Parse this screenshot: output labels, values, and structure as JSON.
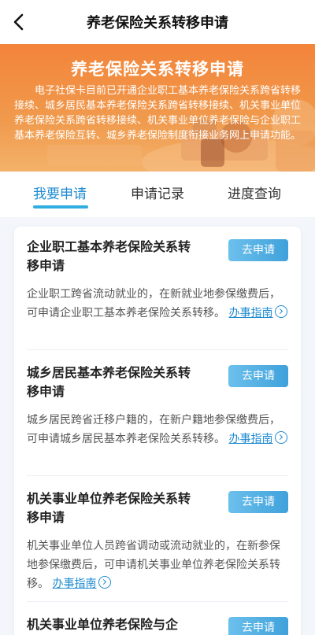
{
  "header": {
    "title": "养老保险关系转移申请"
  },
  "banner": {
    "title": "养老保险关系转移申请",
    "description": "电子社保卡目前已开通企业职工基本养老保险关系跨省转移接续、城乡居民基本养老保险关系跨省转移接续、机关事业单位养老保险关系跨省转移接续、机关事业单位养老保险与企业职工基本养老保险互转、城乡养老保险制度衔接业务网上申请功能。"
  },
  "tabs": [
    {
      "label": "我要申请",
      "active": true
    },
    {
      "label": "申请记录",
      "active": false
    },
    {
      "label": "进度查询",
      "active": false
    }
  ],
  "items": [
    {
      "title": "企业职工基本养老保险关系转移申请",
      "button": "去申请",
      "desc": "企业职工跨省流动就业的，在新就业地参保缴费后，可申请企业职工基本养老保险关系转移。",
      "link": "办事指南"
    },
    {
      "title": "城乡居民基本养老保险关系转移申请",
      "button": "去申请",
      "desc": "城乡居民跨省迁移户籍的，在新户籍地参保缴费后，可申请城乡居民基本养老保险关系转移。",
      "link": "办事指南"
    },
    {
      "title": "机关事业单位养老保险关系转移申请",
      "button": "去申请",
      "desc": "机关事业单位人员跨省调动或流动就业的，在新参保地参保缴费后，可申请机关事业单位养老保险关系转移。",
      "link": "办事指南"
    },
    {
      "title": "机关事业单位养老保险与企",
      "button": "去申请"
    }
  ],
  "colors": {
    "banner": "#f3843a",
    "accent": "#1f8bd1",
    "button": "#3fa1db"
  },
  "icons": {
    "back": "chevron-left-icon",
    "guide": "chevron-right-circle-icon"
  }
}
